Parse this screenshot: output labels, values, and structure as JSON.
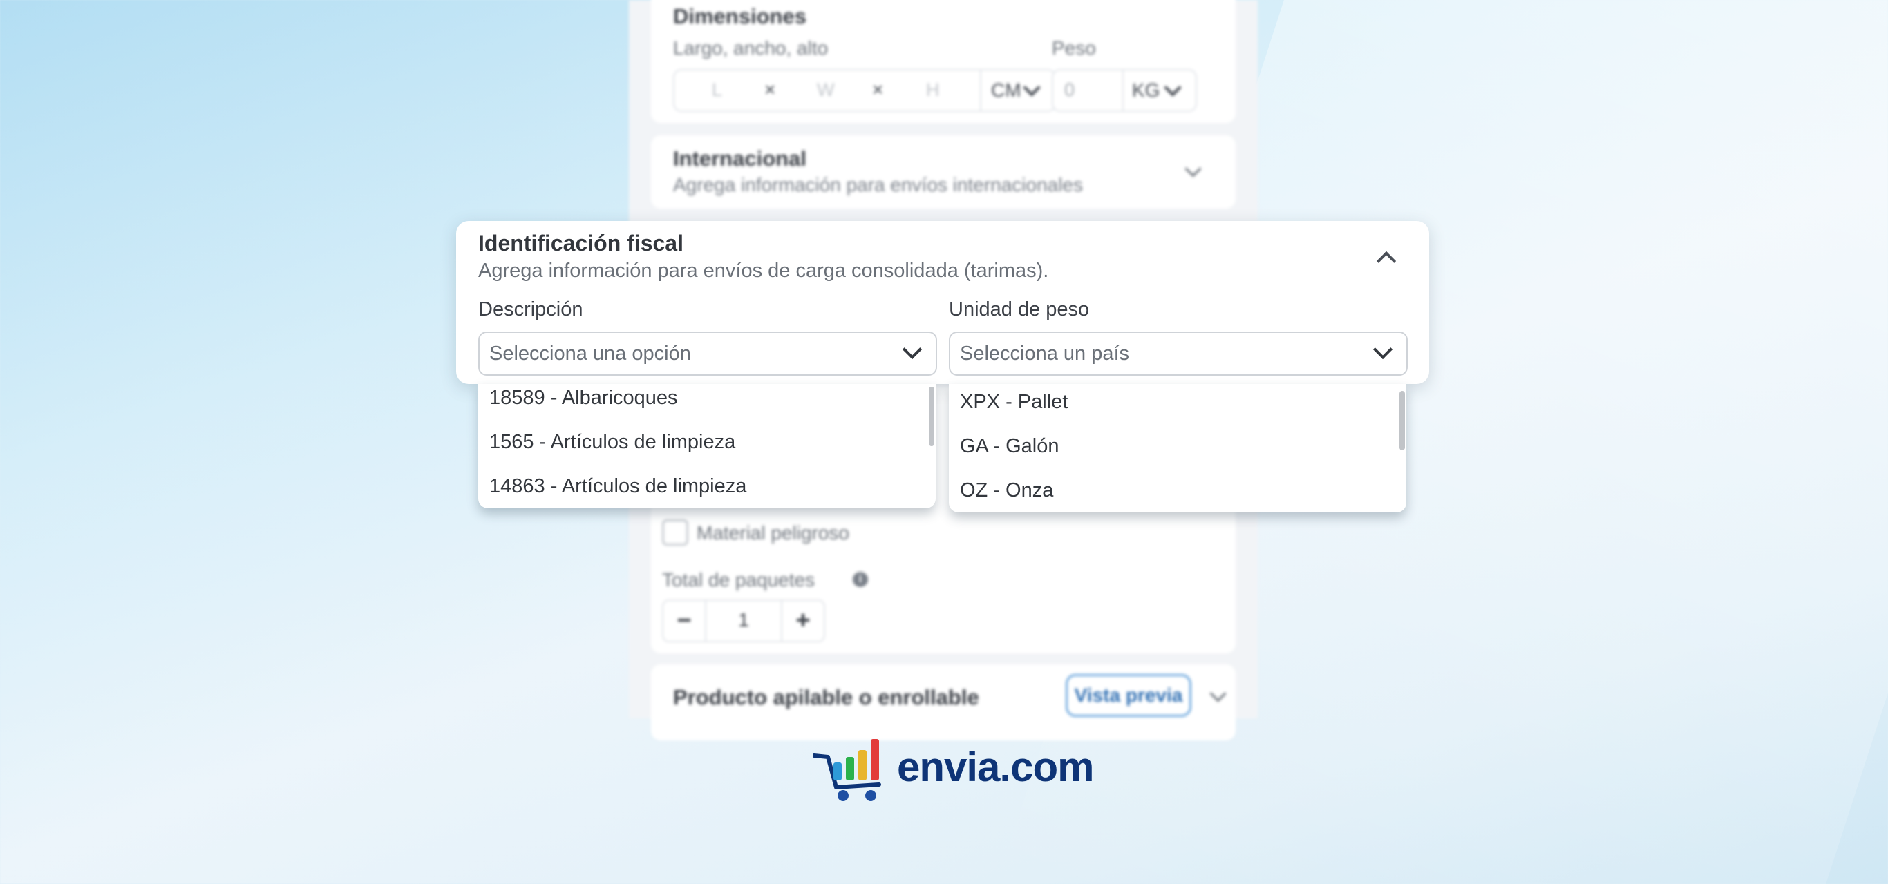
{
  "background_form": {
    "dimensions": {
      "title": "Dimensiones",
      "dims_label": "Largo, ancho, alto",
      "weight_label": "Peso",
      "placeholders": [
        "L",
        "W",
        "H"
      ],
      "times": "×",
      "length_unit": "CM",
      "weight_placeholder": "0",
      "weight_unit": "KG"
    },
    "international": {
      "title": "Internacional",
      "subtitle": "Agrega información para envíos internacionales"
    },
    "hazmat_label": "Material peligroso",
    "packages": {
      "label": "Total de paquetes",
      "info": "i",
      "minus": "−",
      "value": "1",
      "plus": "+"
    },
    "stackable": {
      "title": "Producto apilable o enrollable",
      "preview_label": "Vista previa"
    }
  },
  "modal": {
    "title": "Identificación fiscal",
    "subtitle": "Agrega información para envíos de carga consolidada (tarimas).",
    "description": {
      "label": "Descripción",
      "placeholder": "Selecciona una opción",
      "options": [
        "18589 - Albaricoques",
        "1565 - Artículos de limpieza",
        "14863 - Artículos de limpieza"
      ]
    },
    "weight_unit": {
      "label": "Unidad de peso",
      "placeholder": "Selecciona un país",
      "options": [
        "XPX - Pallet",
        "GA - Galón",
        "OZ - Onza"
      ]
    }
  },
  "logo": {
    "text": "envia.com"
  },
  "colors": {
    "brand": "#0e3477",
    "accent": "#2f6fb3"
  }
}
